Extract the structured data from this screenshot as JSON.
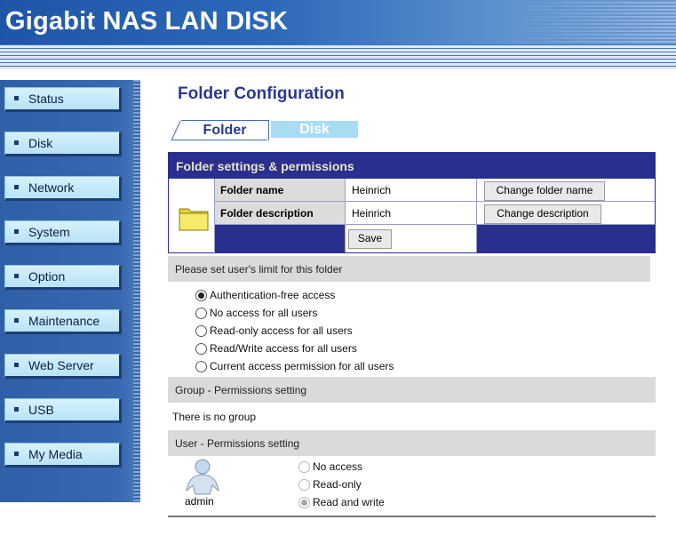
{
  "app": {
    "title": "Gigabit NAS LAN DISK"
  },
  "sidebar": {
    "items": [
      {
        "label": "Status"
      },
      {
        "label": "Disk"
      },
      {
        "label": "Network"
      },
      {
        "label": "System"
      },
      {
        "label": "Option"
      },
      {
        "label": "Maintenance"
      },
      {
        "label": "Web Server"
      },
      {
        "label": "USB"
      },
      {
        "label": "My Media"
      }
    ]
  },
  "page": {
    "title": "Folder Configuration",
    "tabs": [
      {
        "label": "Folder",
        "active": true
      },
      {
        "label": "Disk",
        "active": false
      }
    ]
  },
  "folder_settings": {
    "header": "Folder settings & permissions",
    "name_label": "Folder name",
    "name_value": "Heinrich",
    "change_name_button": "Change folder name",
    "description_label": "Folder description",
    "description_value": "Heinrich",
    "change_description_button": "Change description",
    "save_button": "Save"
  },
  "user_limit": {
    "header": "Please set user's limit for this folder",
    "options": [
      "Authentication-free access",
      "No access for all users",
      "Read-only access for all users",
      "Read/Write access for all users",
      "Current access permission for all users"
    ],
    "selected_index": 0
  },
  "group_permissions": {
    "header": "Group - Permissions setting",
    "empty_text": "There is no group"
  },
  "user_permissions": {
    "header": "User - Permissions setting",
    "user": "admin",
    "options": [
      "No access",
      "Read-only",
      "Read and write"
    ],
    "selected_index": 2
  },
  "colors": {
    "header_blue": "#2d68b8",
    "sidebar_blue": "#3868b0",
    "table_navy": "#2a2f8e",
    "title_color": "#2b3a8f",
    "tab_inactive": "#a8dcf3"
  }
}
